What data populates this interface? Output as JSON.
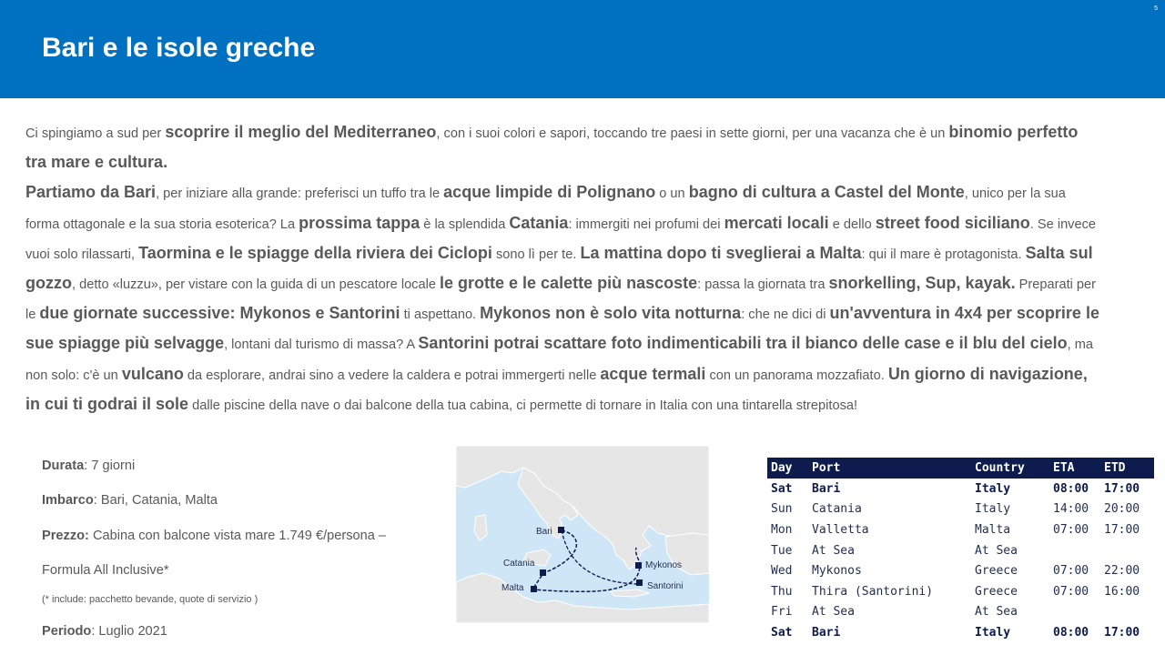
{
  "header": {
    "title": "Bari e le isole greche",
    "page_number": "5"
  },
  "body": [
    {
      "t": "Ci spingiamo a sud per "
    },
    {
      "b": "scoprire il meglio del Mediterraneo"
    },
    {
      "t": ", con i suoi colori e sapori, toccando tre paesi in sette giorni, per una vacanza  che è un "
    },
    {
      "b": "binomio perfetto tra mare e cultura."
    },
    {
      "br": true
    },
    {
      "b": "Partiamo da Bari"
    },
    {
      "t": ", per iniziare alla grande: preferisci un tuffo  tra le "
    },
    {
      "b": "acque limpide di Polignano"
    },
    {
      "t": " o un "
    },
    {
      "b": "bagno di cultura a Castel del Monte"
    },
    {
      "t": ", unico per la sua forma ottagonale  e la sua storia esoterica? La "
    },
    {
      "b": "prossima tappa"
    },
    {
      "t": " è la splendida "
    },
    {
      "b": "Catania"
    },
    {
      "t": ": immergiti nei profumi  dei "
    },
    {
      "b": "mercati locali"
    },
    {
      "t": " e dello "
    },
    {
      "b": "street food siciliano"
    },
    {
      "t": ".  Se invece vuoi solo rilassarti, "
    },
    {
      "b": "Taormina e le spiagge della riviera dei Ciclopi"
    },
    {
      "t": " sono lì per te. "
    },
    {
      "b": "La mattina dopo ti sveglierai a Malta"
    },
    {
      "t": ": qui il mare è protagonista.  "
    },
    {
      "b": "Salta sul gozzo"
    },
    {
      "t": ", detto «luzzu»,  per vistare con la guida di un pescatore locale "
    },
    {
      "b": "le grotte e le calette più nascoste"
    },
    {
      "t": ": passa la giornata tra "
    },
    {
      "b": "snorkelling, Sup, kayak."
    },
    {
      "t": " Preparati per le "
    },
    {
      "b": "due giornate successive: Mykonos e Santorini"
    },
    {
      "t": " ti aspettano.  "
    },
    {
      "b": "Mykonos non è solo vita notturna"
    },
    {
      "t": ": che ne dici di "
    },
    {
      "b": "un'avventura in 4x4 per scoprire le sue spiagge più selvagge"
    },
    {
      "t": ", lontani  dal turismo di massa? A "
    },
    {
      "b": "Santorini potrai scattare foto indimenticabili tra il bianco delle case e il blu del cielo"
    },
    {
      "t": ", ma non solo: c'è un "
    },
    {
      "b": "vulcano"
    },
    {
      "t": " da esplorare, andrai sino a vedere la caldera e potrai immergerti nelle "
    },
    {
      "b": "acque termali"
    },
    {
      "t": " con un panorama mozzafiato.  "
    },
    {
      "b": "Un giorno di navigazione, in cui ti godrai il sole"
    },
    {
      "t": " dalle piscine della nave  o dai balcone della tua cabina, ci permette di tornare  in Italia  con una tintarella strepitosa!"
    }
  ],
  "info": {
    "durata_label": "Durata",
    "durata_value": ": 7 giorni",
    "imbarco_label": "Imbarco",
    "imbarco_value": ": Bari, Catania, Malta",
    "prezzo_label": "Prezzo:",
    "prezzo_value": " Cabina con balcone vista mare 1.749 €/persona –",
    "prezzo_line2": "Formula All Inclusive*",
    "note": "(* include: pacchetto bevande, quote di servizio )",
    "periodo_label": "Periodo",
    "periodo_value": ": Luglio 2021"
  },
  "map": {
    "colors": {
      "sea": "#cfe6f7",
      "land": "#e6e6e6",
      "border": "#ffffff",
      "route": "#0d1b4d"
    },
    "labels": {
      "bari": "Bari",
      "catania": "Catania",
      "malta": "Malta",
      "mykonos": "Mykonos",
      "santorini": "Santorini"
    }
  },
  "schedule": {
    "headers": [
      "Day",
      "Port",
      "Country",
      "ETA",
      "ETD"
    ],
    "rows": [
      {
        "day": "Sat",
        "port": "Bari",
        "country": "Italy",
        "eta": "08:00",
        "etd": "17:00",
        "bold": true
      },
      {
        "day": "Sun",
        "port": "Catania",
        "country": "Italy",
        "eta": "14:00",
        "etd": "20:00",
        "bold": false
      },
      {
        "day": "Mon",
        "port": "Valletta",
        "country": "Malta",
        "eta": "07:00",
        "etd": "17:00",
        "bold": false
      },
      {
        "day": "Tue",
        "port": "At Sea",
        "country": "At Sea",
        "eta": "",
        "etd": "",
        "bold": false
      },
      {
        "day": "Wed",
        "port": "Mykonos",
        "country": "Greece",
        "eta": "07:00",
        "etd": "22:00",
        "bold": false
      },
      {
        "day": "Thu",
        "port": "Thira (Santorini)",
        "country": "Greece",
        "eta": "07:00",
        "etd": "16:00",
        "bold": false
      },
      {
        "day": "Fri",
        "port": "At Sea",
        "country": "At Sea",
        "eta": "",
        "etd": "",
        "bold": false
      },
      {
        "day": "Sat",
        "port": "Bari",
        "country": "Italy",
        "eta": "08:00",
        "etd": "17:00",
        "bold": true
      }
    ]
  }
}
